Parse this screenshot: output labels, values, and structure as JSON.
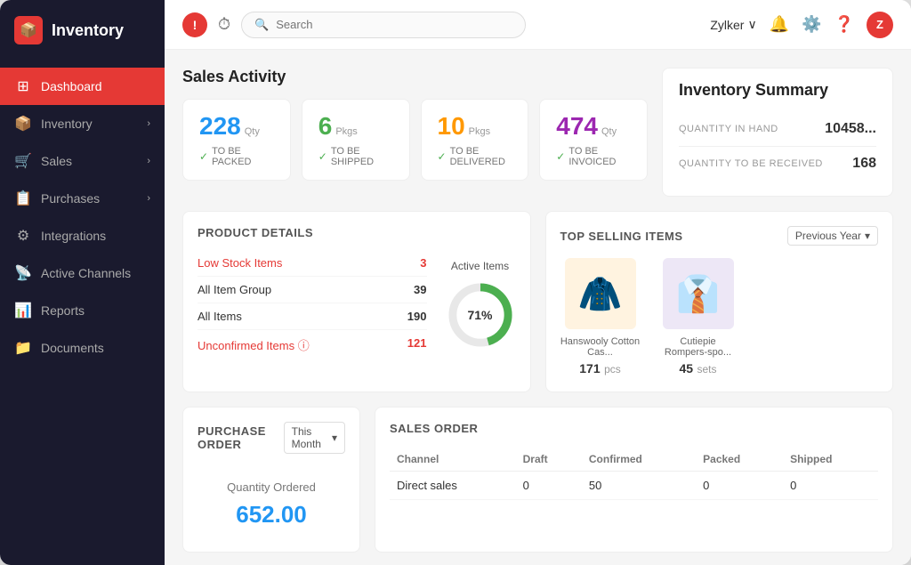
{
  "sidebar": {
    "logo": {
      "text": "Inventory",
      "icon": "📦"
    },
    "items": [
      {
        "id": "dashboard",
        "label": "Dashboard",
        "icon": "⊞",
        "active": true,
        "hasArrow": false
      },
      {
        "id": "inventory",
        "label": "Inventory",
        "icon": "📦",
        "active": false,
        "hasArrow": true
      },
      {
        "id": "sales",
        "label": "Sales",
        "icon": "🛒",
        "active": false,
        "hasArrow": true
      },
      {
        "id": "purchases",
        "label": "Purchases",
        "icon": "📋",
        "active": false,
        "hasArrow": true
      },
      {
        "id": "integrations",
        "label": "Integrations",
        "icon": "⚙",
        "active": false,
        "hasArrow": false
      },
      {
        "id": "active-channels",
        "label": "Active Channels",
        "icon": "📡",
        "active": false,
        "hasArrow": false
      },
      {
        "id": "reports",
        "label": "Reports",
        "icon": "📊",
        "active": false,
        "hasArrow": false
      },
      {
        "id": "documents",
        "label": "Documents",
        "icon": "📁",
        "active": false,
        "hasArrow": false
      }
    ]
  },
  "topbar": {
    "search_placeholder": "Search",
    "company": "Zylker",
    "avatar_initials": "Z"
  },
  "sales_activity": {
    "title": "Sales Activity",
    "cards": [
      {
        "number": "228",
        "unit": "Qty",
        "label": "TO BE PACKED",
        "color": "blue"
      },
      {
        "number": "6",
        "unit": "Pkgs",
        "label": "TO BE SHIPPED",
        "color": "green"
      },
      {
        "number": "10",
        "unit": "Pkgs",
        "label": "TO BE DELIVERED",
        "color": "orange"
      },
      {
        "number": "474",
        "unit": "Qty",
        "label": "TO BE INVOICED",
        "color": "purple"
      }
    ]
  },
  "inventory_summary": {
    "title": "Inventory Summary",
    "rows": [
      {
        "label": "QUANTITY IN HAND",
        "value": "10458..."
      },
      {
        "label": "QUANTITY TO BE RECEIVED",
        "value": "168"
      }
    ]
  },
  "product_details": {
    "title": "PRODUCT DETAILS",
    "rows": [
      {
        "label": "Low Stock Items",
        "value": "3",
        "highlight": true
      },
      {
        "label": "All Item Group",
        "value": "39",
        "highlight": false
      },
      {
        "label": "All Items",
        "value": "190",
        "highlight": false
      },
      {
        "label": "Unconfirmed Items ⓘ",
        "value": "121",
        "highlight": true
      }
    ],
    "donut": {
      "label": "Active Items",
      "percent": "71%",
      "filled": 71,
      "total": 100
    }
  },
  "top_selling": {
    "title": "TOP SELLING ITEMS",
    "period": "Previous Year",
    "items": [
      {
        "name": "Hanswooly Cotton Cas...",
        "qty": "171",
        "unit": "pcs",
        "emoji": "🧥"
      },
      {
        "name": "Cutiepie Rompers-spo...",
        "qty": "45",
        "unit": "sets",
        "emoji": "👔"
      }
    ]
  },
  "purchase_order": {
    "title": "PURCHASE ORDER",
    "period": "This Month",
    "qty_label": "Quantity Ordered",
    "qty_value": "652.00"
  },
  "sales_order": {
    "title": "SALES ORDER",
    "columns": [
      "Channel",
      "Draft",
      "Confirmed",
      "Packed",
      "Shipped"
    ],
    "rows": [
      {
        "channel": "Direct sales",
        "draft": "0",
        "confirmed": "50",
        "packed": "0",
        "shipped": "0"
      }
    ]
  }
}
